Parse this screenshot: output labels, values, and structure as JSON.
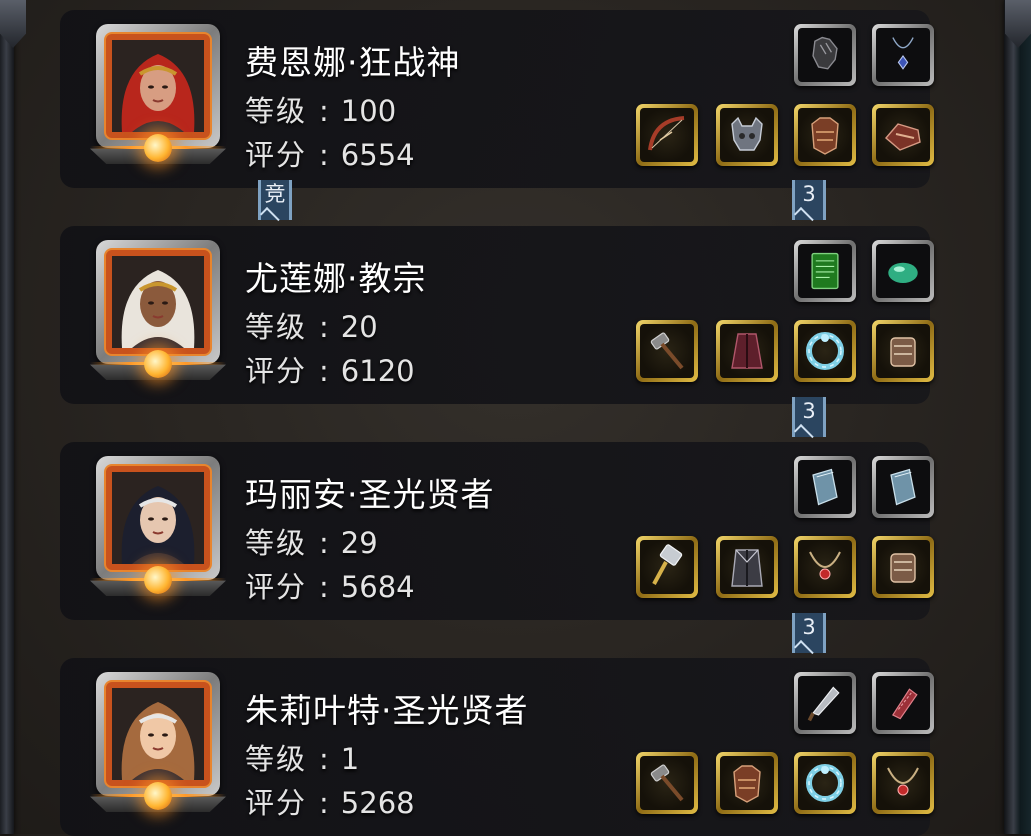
{
  "heroes": [
    {
      "name": "费恩娜·狂战神",
      "level_label": "等级",
      "level": "100",
      "score_label": "评分",
      "score": "6554",
      "portrait": {
        "hair": "#b8261c",
        "skin": "#d79d82",
        "band": "#c9962e"
      },
      "equipment_top": [
        {
          "icon": "gloves-icon",
          "frame": "silver"
        },
        {
          "icon": "amulet-icon",
          "frame": "silver"
        }
      ],
      "equipment_bottom": [
        {
          "icon": "bow-icon",
          "frame": "gold"
        },
        {
          "icon": "helmet-icon",
          "frame": "gold"
        },
        {
          "icon": "armor-icon",
          "frame": "gold"
        },
        {
          "icon": "gauntlet-icon",
          "frame": "gold"
        }
      ]
    },
    {
      "name": "尤莲娜·教宗",
      "level_label": "等级",
      "level": "20",
      "score_label": "评分",
      "score": "6120",
      "portrait": {
        "hair": "#e9e4dc",
        "skin": "#8b5a3c",
        "band": "#c9962e"
      },
      "equipment_top": [
        {
          "icon": "tome-icon",
          "frame": "silver"
        },
        {
          "icon": "gem-icon",
          "frame": "silver"
        }
      ],
      "equipment_bottom": [
        {
          "icon": "hammer-icon",
          "frame": "gold"
        },
        {
          "icon": "robe-icon",
          "frame": "gold"
        },
        {
          "icon": "ring-icon",
          "frame": "gold"
        },
        {
          "icon": "bracer-icon",
          "frame": "gold"
        }
      ]
    },
    {
      "name": "玛丽安·圣光贤者",
      "level_label": "等级",
      "level": "29",
      "score_label": "评分",
      "score": "5684",
      "portrait": {
        "hair": "#1c1f2e",
        "skin": "#e6c7b0",
        "band": "#e6e6e6"
      },
      "equipment_top": [
        {
          "icon": "book-icon",
          "frame": "silver"
        },
        {
          "icon": "book-icon",
          "frame": "silver"
        }
      ],
      "equipment_bottom": [
        {
          "icon": "mace-icon",
          "frame": "gold"
        },
        {
          "icon": "coat-icon",
          "frame": "gold"
        },
        {
          "icon": "necklace-icon",
          "frame": "gold"
        },
        {
          "icon": "bracer-icon",
          "frame": "gold"
        }
      ]
    },
    {
      "name": "朱莉叶特·圣光贤者",
      "level_label": "等级",
      "level": "1",
      "score_label": "评分",
      "score": "5268",
      "portrait": {
        "hair": "#a56a3e",
        "skin": "#f0c8a6",
        "band": "#e6e6e6"
      },
      "equipment_top": [
        {
          "icon": "dagger-icon",
          "frame": "silver"
        },
        {
          "icon": "relic-icon",
          "frame": "silver"
        }
      ],
      "equipment_bottom": [
        {
          "icon": "hammer-icon",
          "frame": "gold"
        },
        {
          "icon": "armor-icon",
          "frame": "gold"
        },
        {
          "icon": "ring-icon",
          "frame": "gold"
        },
        {
          "icon": "necklace-icon",
          "frame": "gold"
        }
      ]
    }
  ],
  "connectors": [
    {
      "label": "竞"
    },
    {
      "label": "3"
    },
    {
      "label": "3"
    },
    {
      "label": "3"
    }
  ],
  "colors": {
    "accent_gold": "#d9b43c",
    "connector_blue": "#2b4560",
    "portrait_orange": "#c8521d"
  }
}
